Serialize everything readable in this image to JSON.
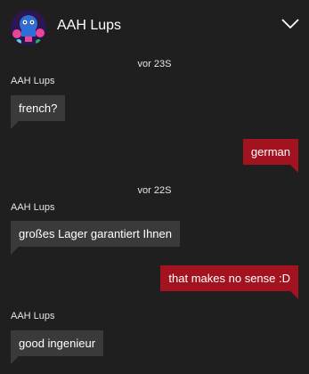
{
  "header": {
    "contact_name": "AAH Lups",
    "avatar_icon": "group-avatar",
    "collapse_icon": "chevron-down-icon"
  },
  "colors": {
    "background": "#1f1f1f",
    "incoming_bubble": "#3a3a3a",
    "outgoing_bubble": "#a3121f"
  },
  "messages": [
    {
      "type": "timestamp",
      "text": "vor 23S"
    },
    {
      "type": "sender",
      "text": "AAH Lups"
    },
    {
      "type": "incoming",
      "text": "french?"
    },
    {
      "type": "outgoing",
      "text": "german"
    },
    {
      "type": "timestamp",
      "text": "vor 22S"
    },
    {
      "type": "sender",
      "text": "AAH Lups"
    },
    {
      "type": "incoming",
      "text": "großes Lager garantiert Ihnen"
    },
    {
      "type": "outgoing",
      "text": "that makes no sense :D"
    },
    {
      "type": "sender",
      "text": "AAH Lups"
    },
    {
      "type": "incoming",
      "text": "good ingenieur"
    }
  ]
}
